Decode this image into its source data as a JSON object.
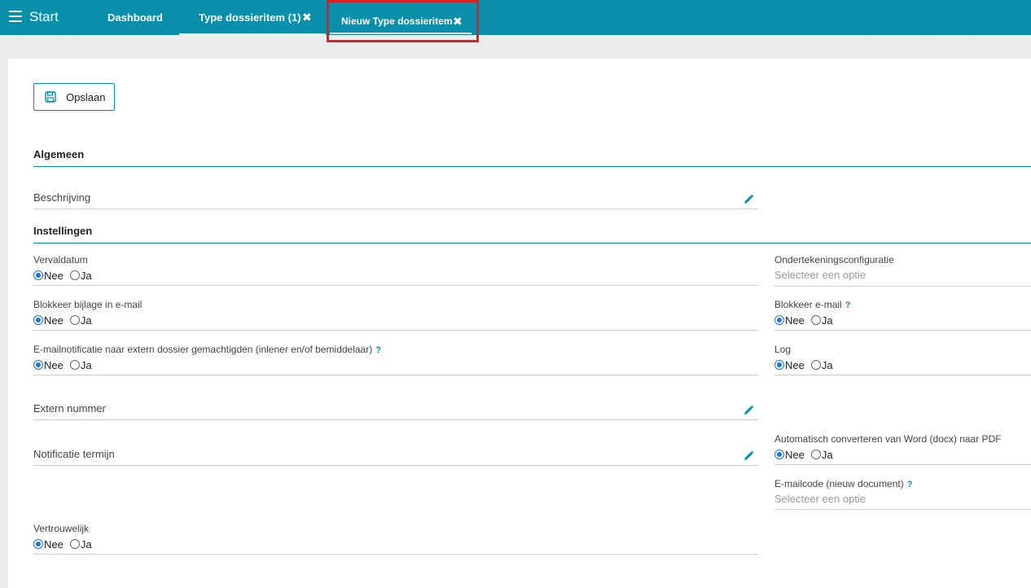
{
  "topbar": {
    "start_label": "Start",
    "tabs": [
      {
        "label": "Dashboard"
      },
      {
        "label": "Type dossieritem (1)"
      },
      {
        "label": "Nieuw Type dossieritem"
      }
    ],
    "close_glyph": "✖"
  },
  "toolbar": {
    "save_label": "Opslaan"
  },
  "sections": {
    "general": "Algemeen",
    "settings": "Instellingen"
  },
  "fields": {
    "beschrijving": "Beschrijving",
    "vervaldatum": "Vervaldatum",
    "blokkeer_bijlage": "Blokkeer bijlage in e-mail",
    "emailnotificatie": "E-mailnotificatie naar extern dossier gemachtigden (inlener en/of bemiddelaar)",
    "extern_nummer": "Extern nummer",
    "notificatie_termijn": "Notificatie termijn",
    "vertrouwelijk": "Vertrouwelijk",
    "ondertekening": "Ondertekeningsconfiguratie",
    "blokkeer_email": "Blokkeer e-mail",
    "log": "Log",
    "auto_convert": "Automatisch converteren van Word (docx) naar PDF",
    "emailcode": "E-mailcode (nieuw document)"
  },
  "options": {
    "no": "Nee",
    "yes": "Ja",
    "help": "?"
  },
  "select_placeholder": "Selecteer een optie",
  "colors": {
    "accent": "#0a8fab",
    "highlight": "#e02020",
    "radio": "#1a73e8"
  }
}
